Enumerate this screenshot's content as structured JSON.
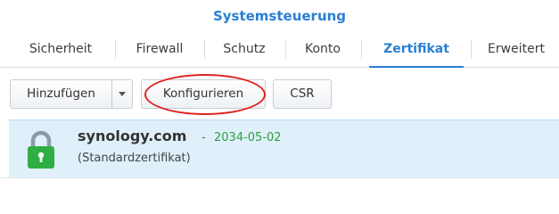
{
  "window": {
    "title": "Systemsteuerung"
  },
  "tabs": [
    {
      "label": "Sicherheit"
    },
    {
      "label": "Firewall"
    },
    {
      "label": "Schutz"
    },
    {
      "label": "Konto"
    },
    {
      "label": "Zertifikat",
      "active": true
    },
    {
      "label": "Erweitert"
    }
  ],
  "toolbar": {
    "add_label": "Hinzufügen",
    "configure_label": "Konfigurieren",
    "csr_label": "CSR"
  },
  "certificates": [
    {
      "name": "synology.com",
      "separator": "-",
      "expiry": "2034-05-02",
      "description": "(Standardzertifikat)",
      "icon": "lock-icon"
    }
  ],
  "colors": {
    "accent": "#2a7fd4",
    "selected_row": "#dff0fb",
    "lock_green": "#2fae43",
    "date_green": "#2e9e3e",
    "annotation_red": "#e02020"
  }
}
